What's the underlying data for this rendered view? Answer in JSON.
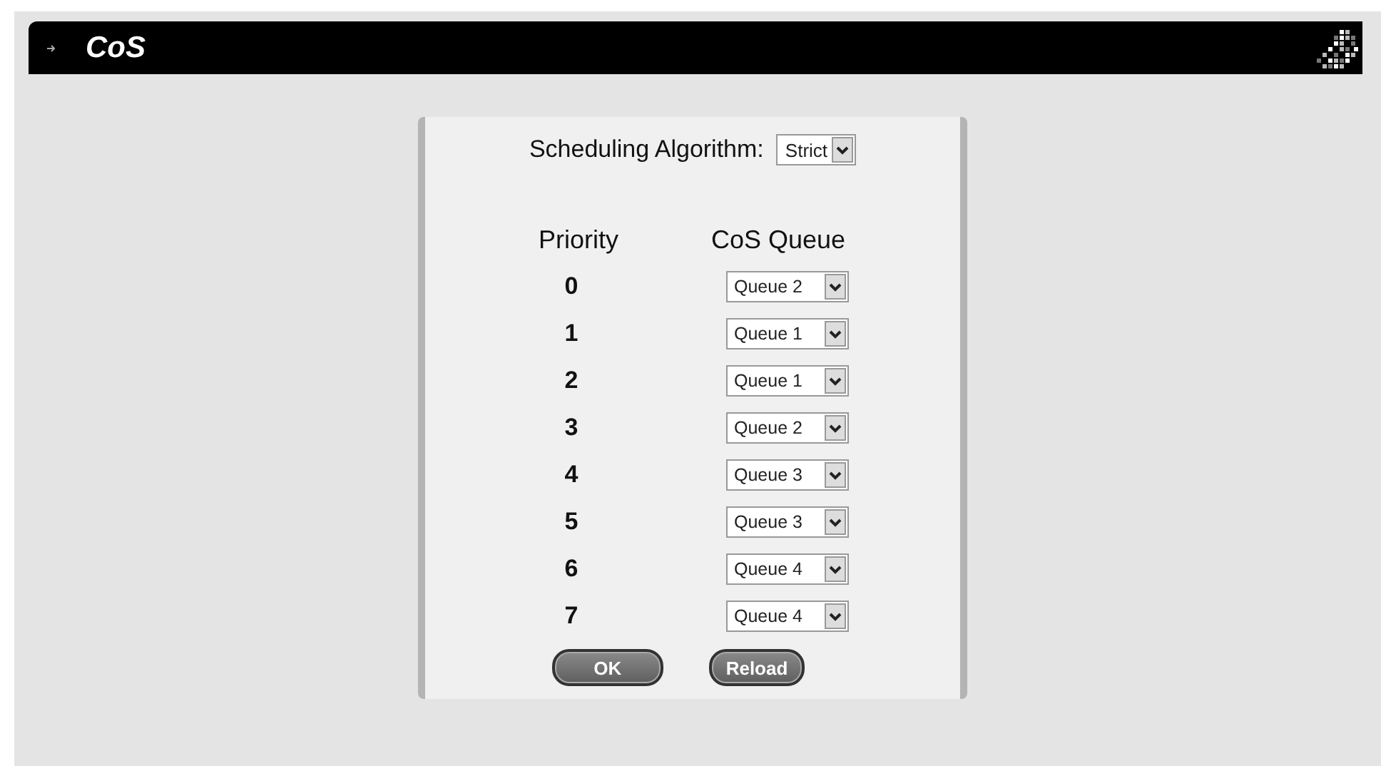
{
  "header": {
    "title": "CoS"
  },
  "scheduling": {
    "label": "Scheduling Algorithm:",
    "value": "Strict"
  },
  "table": {
    "columns": [
      "Priority",
      "CoS Queue"
    ],
    "rows": [
      {
        "priority": "0",
        "queue": "Queue 2"
      },
      {
        "priority": "1",
        "queue": "Queue 1"
      },
      {
        "priority": "2",
        "queue": "Queue 1"
      },
      {
        "priority": "3",
        "queue": "Queue 2"
      },
      {
        "priority": "4",
        "queue": "Queue 3"
      },
      {
        "priority": "5",
        "queue": "Queue 3"
      },
      {
        "priority": "6",
        "queue": "Queue 4"
      },
      {
        "priority": "7",
        "queue": "Queue 4"
      }
    ]
  },
  "buttons": [
    "OK",
    "Reload"
  ]
}
